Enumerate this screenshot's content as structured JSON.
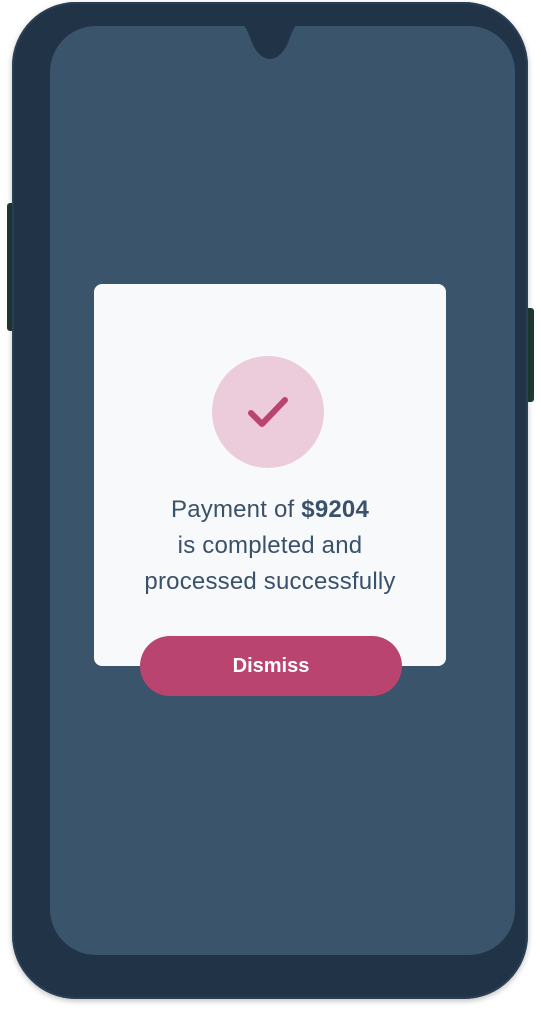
{
  "colors": {
    "phone_frame": "#213447",
    "screen_background": "#39546b",
    "card_background": "#f7f9fb",
    "accent": "#b9446f",
    "check_circle": "#ecccda",
    "text": "#3a516a"
  },
  "dialog": {
    "icon": "checkmark-icon",
    "message_prefix": "Payment of",
    "amount": "$9204",
    "message_line2": "is completed and",
    "message_line3": "processed successfully",
    "dismiss_label": "Dismiss"
  }
}
